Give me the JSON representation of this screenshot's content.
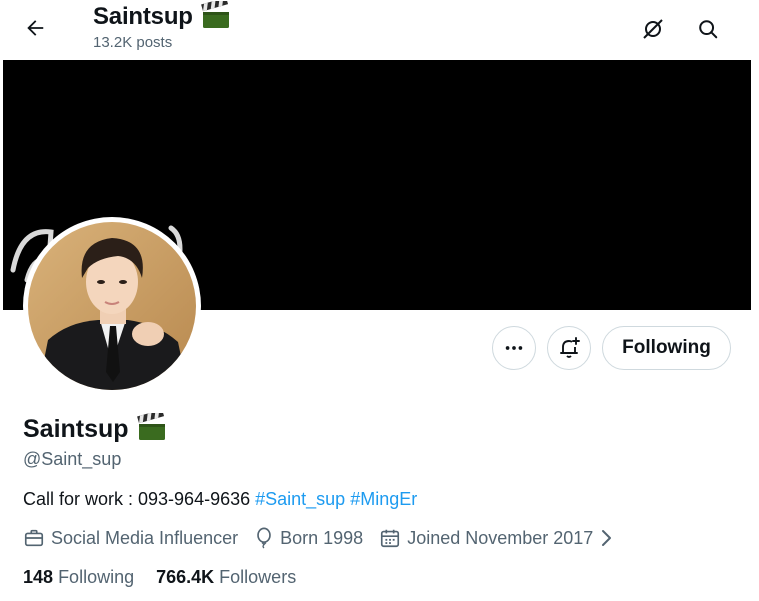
{
  "header": {
    "title": "Saintsup",
    "post_count": "13.2K posts",
    "title_icon": "clapper-board-icon",
    "back_icon": "arrow-left-icon",
    "right_icons": [
      "no-signal-icon",
      "search-icon"
    ]
  },
  "profile": {
    "display_name": "Saintsup",
    "handle": "@Saint_sup",
    "bio_text": "Call for work : 093-964-9636 ",
    "bio_tags": [
      "#Saint_sup",
      "#MingEr"
    ],
    "category": "Social Media Influencer",
    "born": "Born 1998",
    "joined": "Joined November 2017",
    "following_count": "148",
    "following_label": "Following",
    "followers_count": "766.4K",
    "followers_label": "Followers"
  },
  "actions": {
    "more_icon": "more-dots-icon",
    "notify_icon": "bell-plus-icon",
    "follow_button_label": "Following"
  },
  "colors": {
    "accent_link": "#1d9bf0",
    "muted_text": "#536471",
    "primary_text": "#0f1419",
    "border": "#cfd9de",
    "banner": "#000000"
  }
}
